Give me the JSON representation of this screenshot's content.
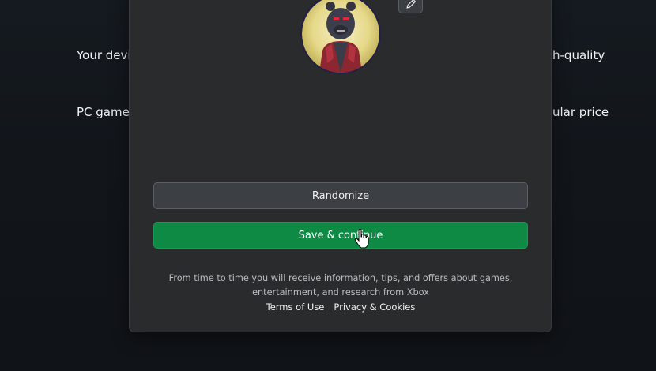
{
  "background": {
    "left_text": [
      "Your devi",
      "PC games"
    ],
    "right_text": [
      "h-quality",
      "ular price"
    ]
  },
  "dialog": {
    "avatar_icon": "gamerpic-avatar",
    "edit_icon": "pencil-icon",
    "randomize_label": "Randomize",
    "save_label": "Save & continue",
    "disclaimer": "From time to time you will receive information, tips, and offers about games, entertainment, and research from Xbox",
    "links": {
      "terms": "Terms of Use",
      "privacy": "Privacy & Cookies"
    }
  },
  "colors": {
    "save_button": "#0e8a45",
    "dialog_bg": "#2a2b2d",
    "page_bg": "#121519"
  }
}
